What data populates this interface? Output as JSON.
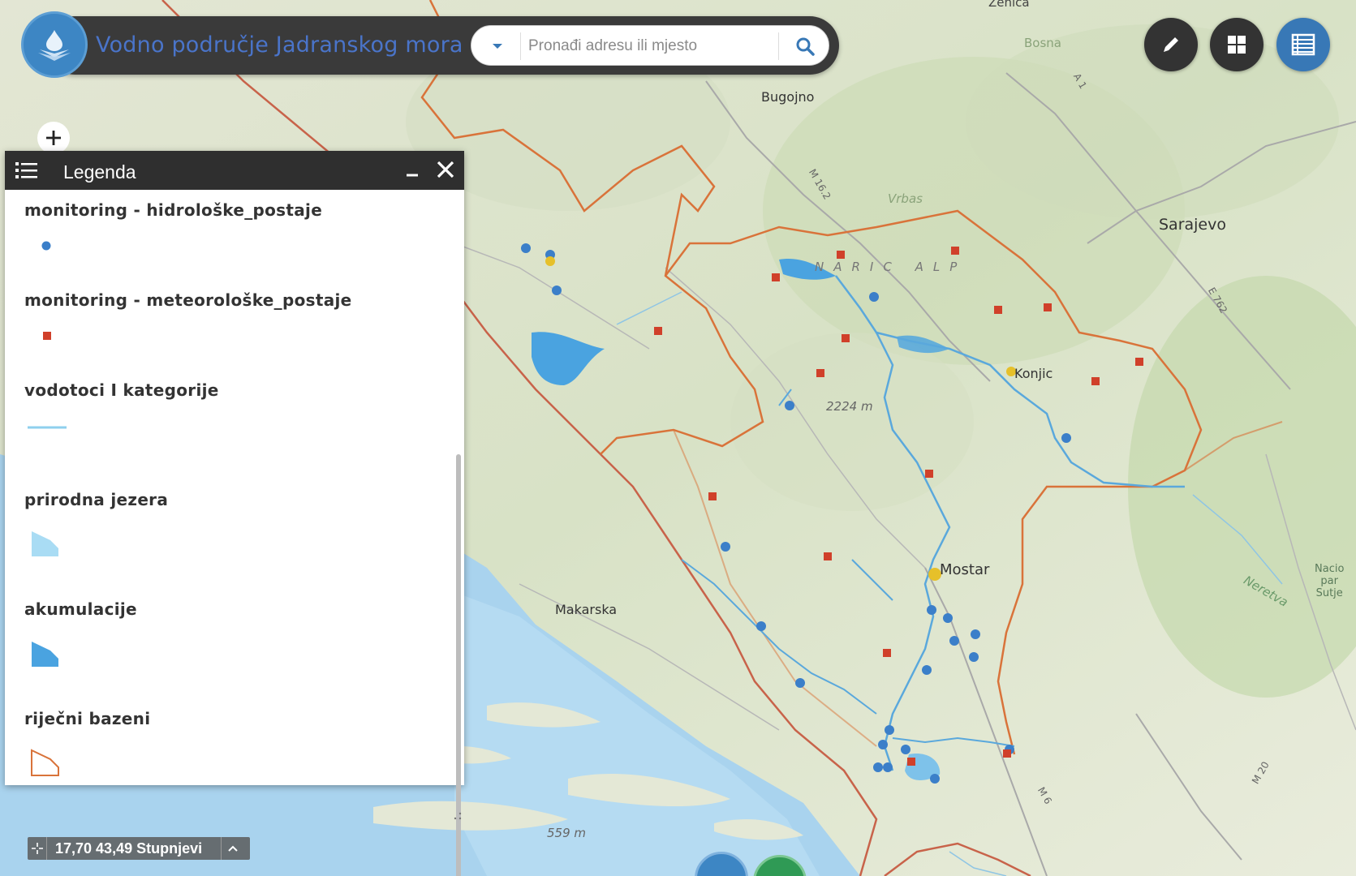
{
  "header": {
    "title": "Vodno područje Jadranskog mora",
    "search_placeholder": "Pronađi adresu ili mjesto"
  },
  "toolbar": {
    "draw_icon": "pencil-icon",
    "layers_icon": "grid-icon",
    "table_icon": "table-icon"
  },
  "legend": {
    "title": "Legenda",
    "items": [
      {
        "label": "monitoring - hidrološke_postaje",
        "symbol": "blue-dot"
      },
      {
        "label": "monitoring - meteorološke_postaje",
        "symbol": "red-square"
      },
      {
        "label": "vodotoci I kategorije",
        "symbol": "light-blue-line"
      },
      {
        "label": "prirodna jezera",
        "symbol": "light-blue-polygon"
      },
      {
        "label": "akumulacije",
        "symbol": "blue-polygon"
      },
      {
        "label": "riječni bazeni",
        "symbol": "orange-outline-polygon"
      }
    ]
  },
  "map": {
    "labels": {
      "zenica": "Zenica",
      "bosna": "Bosna",
      "bugojno": "Bugojno",
      "sarajevo": "Sarajevo",
      "konjic": "Konjic",
      "mostar": "Mostar",
      "makarska": "Makarska",
      "vrbas": "Vrbas",
      "range": "NARIC ALP",
      "elev1": "2224 m",
      "elev2": "559 m",
      "road_m16": "M 16.2",
      "road_e762": "E 762",
      "road_a1": "A 1",
      "road_m6": "M 6",
      "road_m20": "M 20",
      "np": "Nacio\npar\nSutje",
      "neretva": "Neretva"
    }
  },
  "coordinates": {
    "text": "17,70 43,49 Stupnjevi"
  },
  "colors": {
    "header_bg": "#3a3a3a",
    "title_blue": "#4a74c9",
    "station_blue": "#3b7fc9",
    "station_red": "#d0402a",
    "river_blue": "#5aa8dc",
    "basin_orange": "#d9733a",
    "lake_blue": "#4aa3e0"
  }
}
